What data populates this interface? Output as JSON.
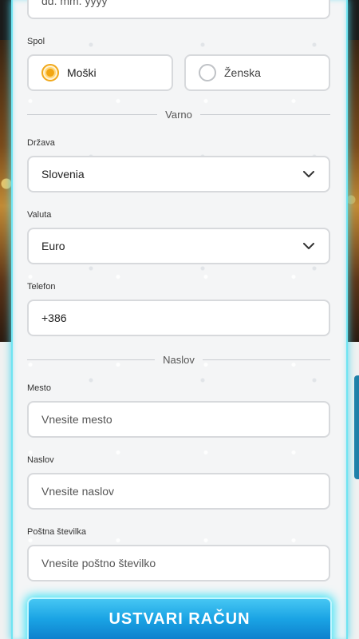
{
  "form": {
    "birthdate": {
      "placeholder": "dd. mm. yyyy"
    },
    "gender": {
      "label": "Spol",
      "options": [
        {
          "label": "Moški",
          "selected": true
        },
        {
          "label": "Ženska",
          "selected": false
        }
      ]
    },
    "section_secure": "Varno",
    "country": {
      "label": "Država",
      "value": "Slovenia"
    },
    "currency": {
      "label": "Valuta",
      "value": "Euro"
    },
    "phone": {
      "label": "Telefon",
      "value": "+386"
    },
    "section_address": "Naslov",
    "city": {
      "label": "Mesto",
      "placeholder": "Vnesite mesto"
    },
    "address": {
      "label": "Naslov",
      "placeholder": "Vnesite naslov"
    },
    "postcode": {
      "label": "Poštna številka",
      "placeholder": "Vnesite poštno številko"
    },
    "submit_label": "USTVARI RAČUN"
  },
  "icons": [
    "chevron-down-icon",
    "radio-selected-icon",
    "radio-unselected-icon"
  ],
  "colors": {
    "accent_orange": "#f2a613",
    "cta_blue": "#1aa3e4",
    "glow_cyan": "#48d6ee"
  }
}
